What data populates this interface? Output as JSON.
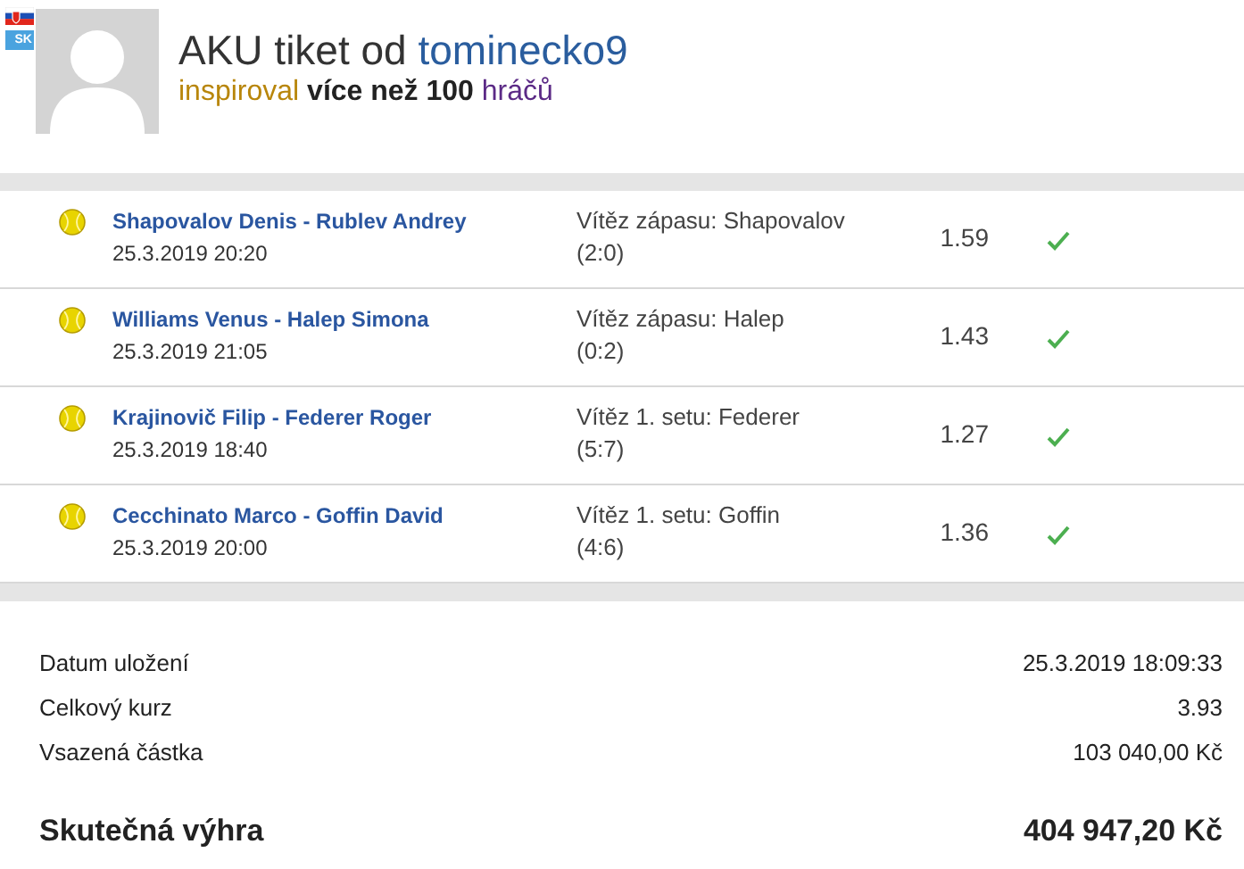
{
  "header": {
    "badge": "SK",
    "title": "AKU tiket od",
    "user": "tominecko9",
    "inspired_prefix": "inspiroval",
    "inspired_count": "více než 100",
    "inspired_suffix": "hráčů"
  },
  "bets": [
    {
      "match": "Shapovalov Denis - Rublev Andrey",
      "date": "25.3.2019 20:20",
      "pick": "Vítěz zápasu: Shapovalov",
      "score": "(2:0)",
      "odds": "1.59",
      "won": true
    },
    {
      "match": "Williams Venus - Halep Simona",
      "date": "25.3.2019 21:05",
      "pick": "Vítěz zápasu: Halep",
      "score": "(0:2)",
      "odds": "1.43",
      "won": true
    },
    {
      "match": "Krajinovič Filip - Federer Roger",
      "date": "25.3.2019 18:40",
      "pick": "Vítěz 1. setu: Federer",
      "score": "(5:7)",
      "odds": "1.27",
      "won": true
    },
    {
      "match": "Cecchinato Marco - Goffin David",
      "date": "25.3.2019 20:00",
      "pick": "Vítěz 1. setu: Goffin",
      "score": "(4:6)",
      "odds": "1.36",
      "won": true
    }
  ],
  "summary": [
    {
      "label": "Datum uložení",
      "value": "25.3.2019 18:09:33"
    },
    {
      "label": "Celkový kurz",
      "value": "3.93"
    },
    {
      "label": "Vsazená částka",
      "value": "103 040,00 Kč"
    }
  ],
  "total": {
    "label": "Skutečná výhra",
    "value": "404 947,20 Kč"
  }
}
